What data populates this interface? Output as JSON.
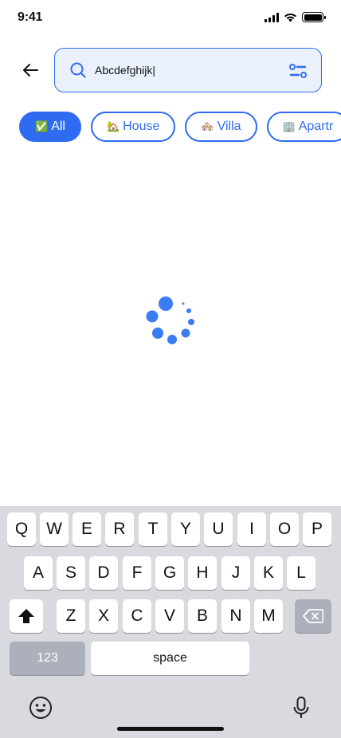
{
  "status_bar": {
    "time": "9:41"
  },
  "search": {
    "value": "Abcdefghijk|"
  },
  "chips": [
    {
      "emoji": "✅",
      "label": "All",
      "active": true
    },
    {
      "emoji": "🏡",
      "label": "House",
      "active": false
    },
    {
      "emoji": "🏘️",
      "label": "Villa",
      "active": false
    },
    {
      "emoji": "🏢",
      "label": "Apartr",
      "active": false
    }
  ],
  "keyboard": {
    "row1": [
      "Q",
      "W",
      "E",
      "R",
      "T",
      "Y",
      "U",
      "I",
      "O",
      "P"
    ],
    "row2": [
      "A",
      "S",
      "D",
      "F",
      "G",
      "H",
      "J",
      "K",
      "L"
    ],
    "row3": [
      "Z",
      "X",
      "C",
      "V",
      "B",
      "N",
      "M"
    ],
    "numbers_label": "123",
    "space_label": "space"
  },
  "colors": {
    "accent": "#2f6bf0",
    "search_bg": "#eaf1fd",
    "keyboard_bg": "#d8dadf"
  },
  "icons": [
    "arrow-left-icon",
    "search-icon",
    "filter-icon",
    "loading-spinner",
    "shift-icon",
    "backspace-icon",
    "emoji-icon",
    "microphone-icon"
  ]
}
